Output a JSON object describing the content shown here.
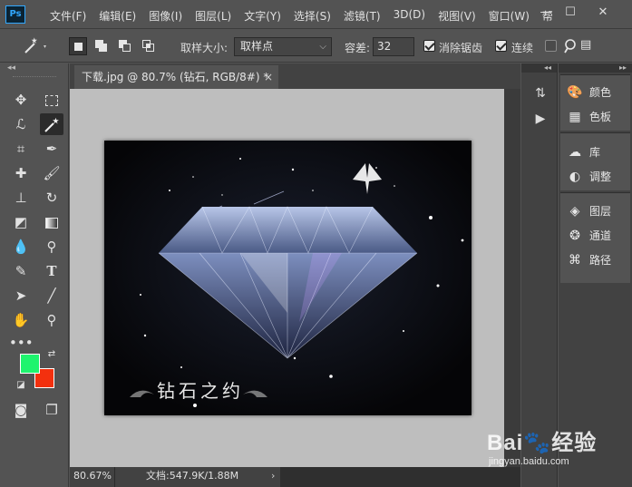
{
  "app": {
    "logo": "Ps",
    "menu": [
      "文件(F)",
      "编辑(E)",
      "图像(I)",
      "图层(L)",
      "文字(Y)",
      "选择(S)",
      "滤镜(T)",
      "3D(D)",
      "视图(V)",
      "窗口(W)",
      "帮"
    ],
    "window_controls": [
      "—",
      "☐",
      "✕"
    ]
  },
  "options": {
    "tool_icon": "magic-wand-icon",
    "sample_size_label": "取样大小:",
    "sample_size_value": "取样点",
    "tolerance_label": "容差:",
    "tolerance_value": "32",
    "anti_alias_label": "消除锯齿",
    "anti_alias_checked": true,
    "contiguous_label": "连续",
    "contiguous_checked": true,
    "all_layers_checked": false
  },
  "toolbar": {
    "foreground_color": "#1ef46e",
    "background_color": "#f3300e",
    "tools": [
      "move-icon",
      "marquee-icon",
      "lasso-icon",
      "magic-wand-icon",
      "crop-icon",
      "eyedropper-icon",
      "healing-icon",
      "brush-icon",
      "stamp-icon",
      "history-brush-icon",
      "eraser-icon",
      "gradient-icon",
      "blur-icon",
      "dodge-icon",
      "pen-icon",
      "type-icon",
      "path-select-icon",
      "line-icon",
      "hand-icon",
      "zoom-icon",
      "more-icon"
    ]
  },
  "document": {
    "tab_title": "下载.jpg @ 80.7% (钻石, RGB/8#) *",
    "tab_close": "×",
    "image_caption": "钻石之约",
    "zoom": "80.67%",
    "doc_info": "文档:547.9K/1.88M",
    "status_arrow": "›"
  },
  "panels": {
    "groups": [
      [
        {
          "label": "颜色",
          "icon": "palette-icon"
        },
        {
          "label": "色板",
          "icon": "swatches-icon"
        }
      ],
      [
        {
          "label": "库",
          "icon": "cc-libraries-icon"
        },
        {
          "label": "调整",
          "icon": "adjustments-icon"
        }
      ],
      [
        {
          "label": "图层",
          "icon": "layers-icon"
        },
        {
          "label": "通道",
          "icon": "channels-icon"
        },
        {
          "label": "路径",
          "icon": "paths-icon"
        }
      ]
    ]
  },
  "watermark": {
    "brand": "Bai🐾经验",
    "url": "jingyan.baidu.com"
  }
}
